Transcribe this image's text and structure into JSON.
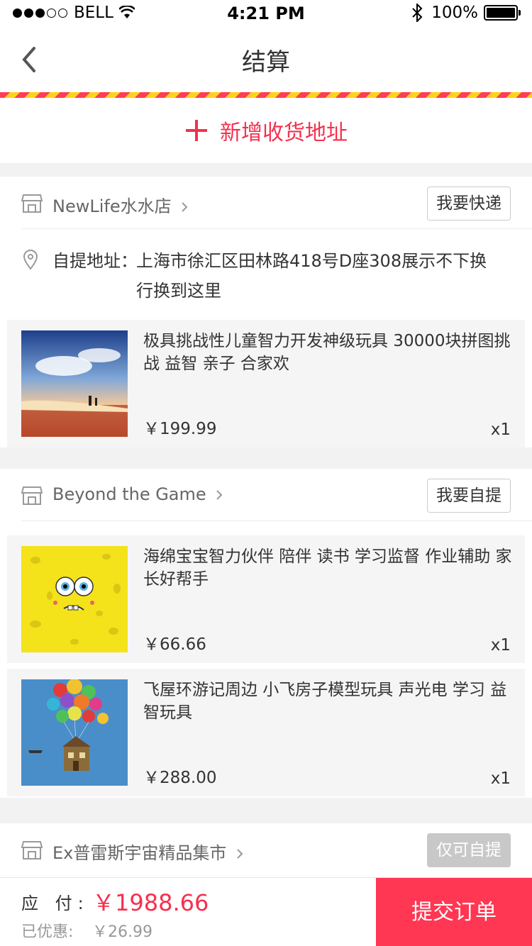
{
  "status_bar": {
    "carrier": "BELL",
    "time": "4:21 PM",
    "battery": "100%"
  },
  "nav": {
    "title": "结算"
  },
  "add_address": {
    "label": "新增收货地址"
  },
  "shops": [
    {
      "name": "NewLife水水店",
      "button": "我要快递",
      "pickup_label": "自提地址：",
      "pickup_value": "上海市徐汇区田林路418号D座308展示不下换行换到这里",
      "items": [
        {
          "title": "极具挑战性儿童智力开发神级玩具  30000块拼图挑战  益智  亲子  合家欢",
          "price": "￥199.99",
          "qty": "x1"
        }
      ]
    },
    {
      "name": "Beyond the Game",
      "button": "我要自提",
      "items": [
        {
          "title": "海绵宝宝智力伙伴  陪伴 读书 学习监督 作业辅助 家长好帮手",
          "price": "￥66.66",
          "qty": "x1"
        },
        {
          "title": "飞屋环游记周边  小飞房子模型玩具  声光电 学习 益智玩具",
          "price": "￥288.00",
          "qty": "x1"
        }
      ]
    },
    {
      "name": "Ex普雷斯宇宙精品集市",
      "button": "仅可自提"
    }
  ],
  "bottom": {
    "pay_label": "应 付:",
    "pay_value": "￥1988.66",
    "discount_label": "已优惠:",
    "discount_value": "￥26.99",
    "submit": "提交订单"
  },
  "colors": {
    "accent": "#ff3753",
    "price_red": "#f5304d"
  }
}
